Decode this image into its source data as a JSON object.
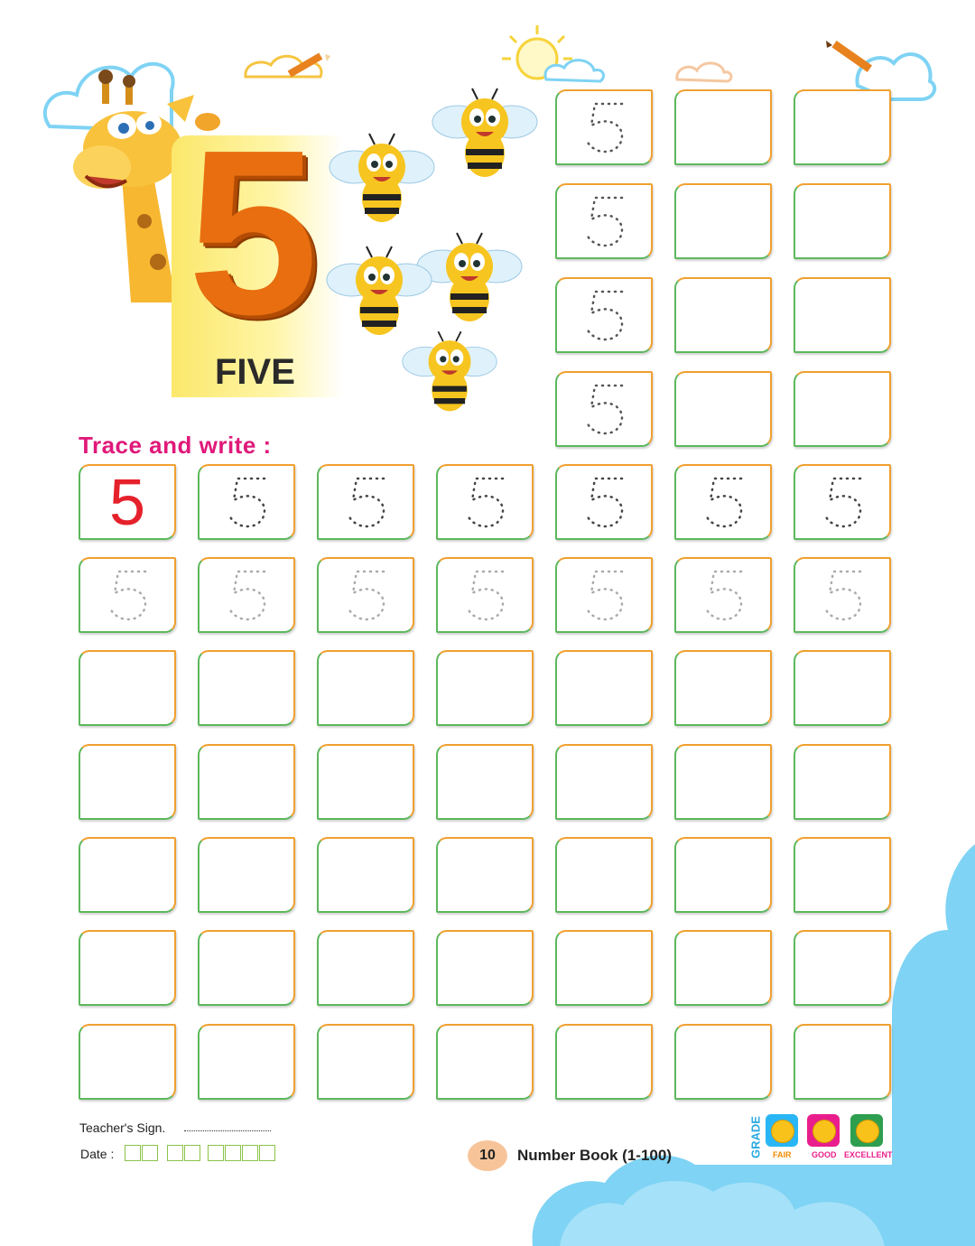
{
  "header": {
    "big_digit": "5",
    "number_word": "FIVE"
  },
  "worksheet": {
    "instruction": "Trace and write :",
    "model_digit": "5",
    "trace_digit": "5"
  },
  "footer": {
    "teacher_sign_label": "Teacher's Sign.",
    "date_label": "Date :",
    "page_number": "10",
    "book_title": "Number Book (1-100)",
    "grade_label": "GRADE",
    "grades": [
      "FAIR",
      "GOOD",
      "EXCELLENT"
    ]
  },
  "colors": {
    "box_green": "#5cb85c",
    "box_orange": "#f0a030",
    "title_pink": "#e0197a",
    "digit_red": "#e5212b",
    "big5_orange": "#e86e10",
    "cloud_blue": "#7fd3f4",
    "fair_tile": "#29b6f6",
    "good_tile": "#e91e8c",
    "excellent_tile": "#2e9e4f"
  },
  "illustrations": [
    "giraffe",
    "bees",
    "clouds",
    "sun",
    "pencils"
  ]
}
